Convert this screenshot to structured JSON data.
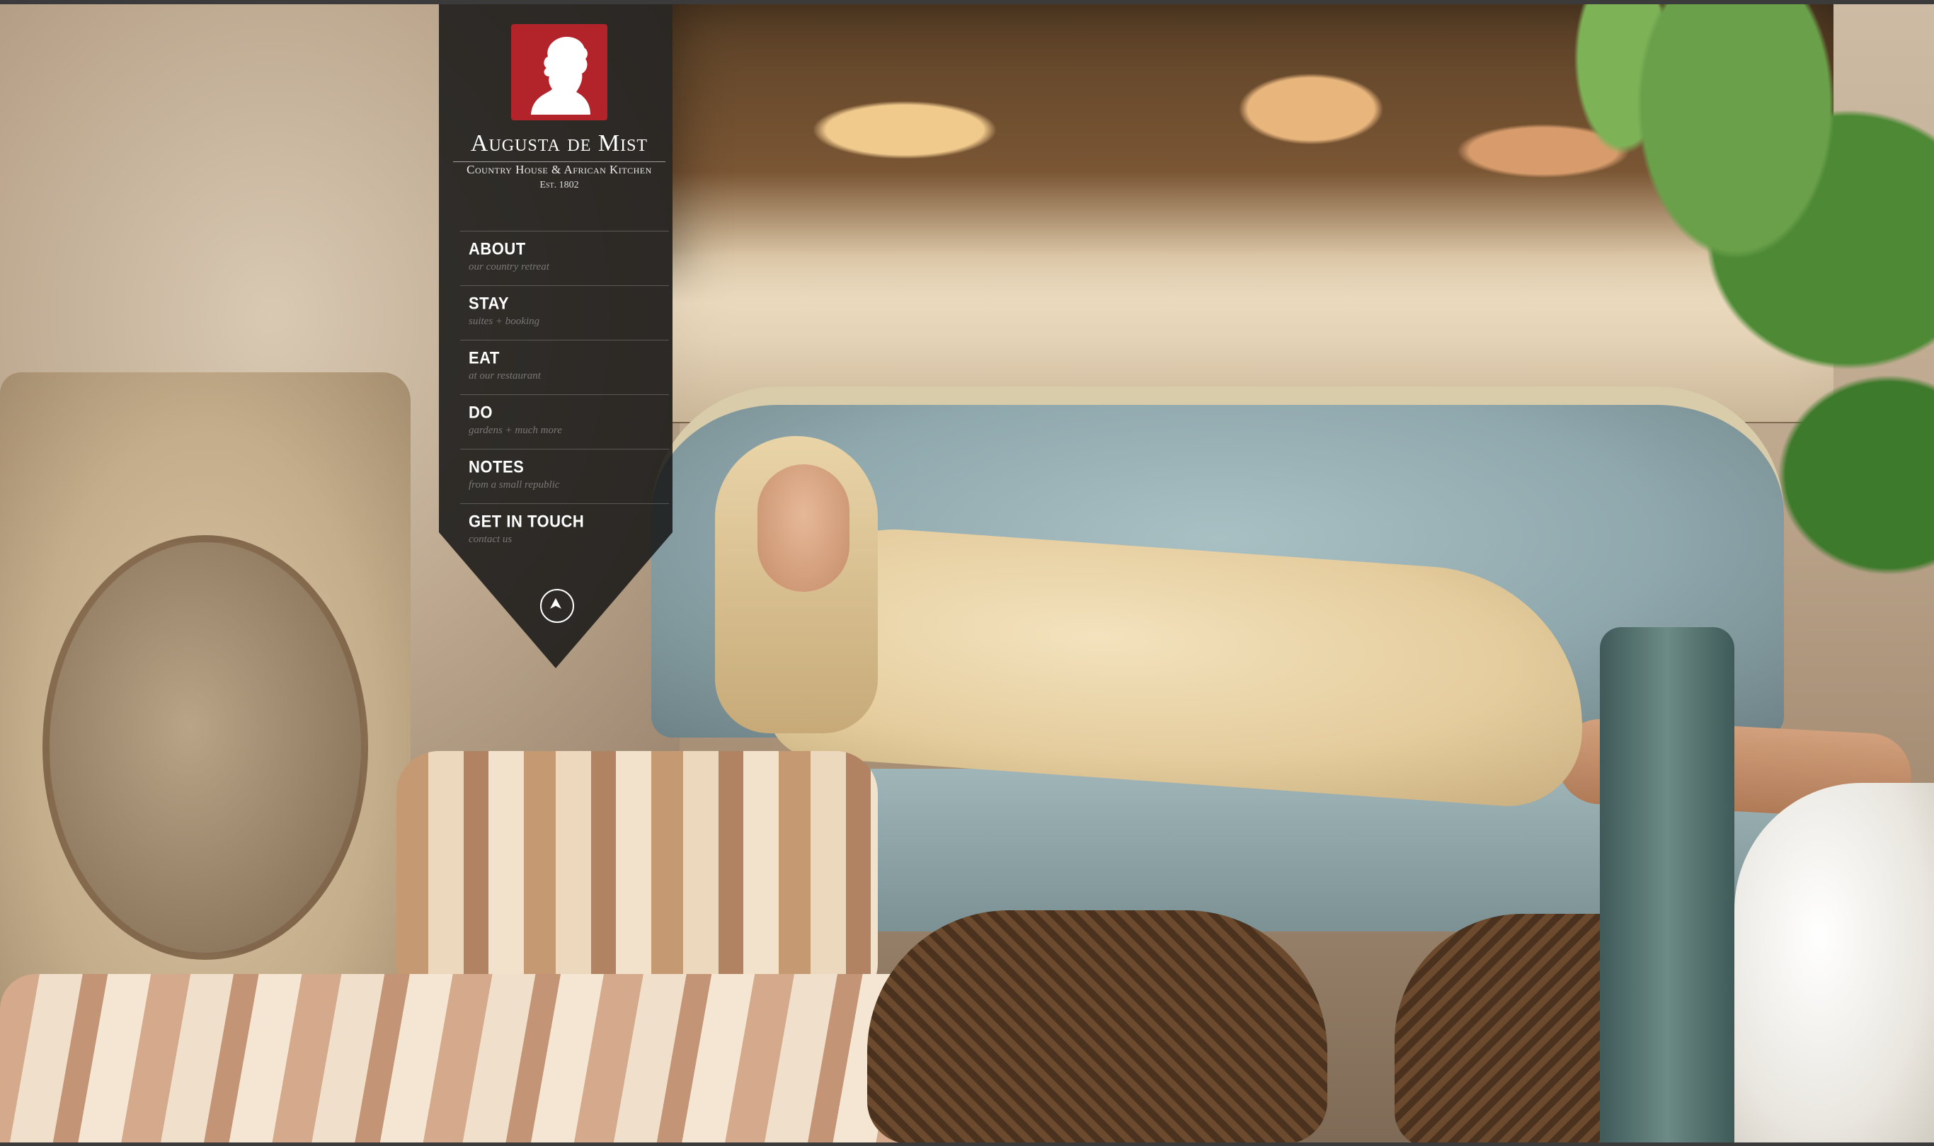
{
  "brand": {
    "name": "Augusta de Mist",
    "tagline": "Country House & African Kitchen",
    "est": "Est. 1802",
    "logo_icon": "woman-silhouette-cameo",
    "accent_color": "#b2232a"
  },
  "nav": {
    "items": [
      {
        "title": "ABOUT",
        "subtitle": "our country retreat"
      },
      {
        "title": "STAY",
        "subtitle": "suites + booking"
      },
      {
        "title": "EAT",
        "subtitle": "at our restaurant"
      },
      {
        "title": "DO",
        "subtitle": "gardens + much more"
      },
      {
        "title": "NOTES",
        "subtitle": "from a small republic"
      },
      {
        "title": "GET IN TOUCH",
        "subtitle": "contact us"
      }
    ],
    "scroll_up_icon": "up-arrow-circle-icon",
    "panel_color": "#1c1c1c"
  }
}
